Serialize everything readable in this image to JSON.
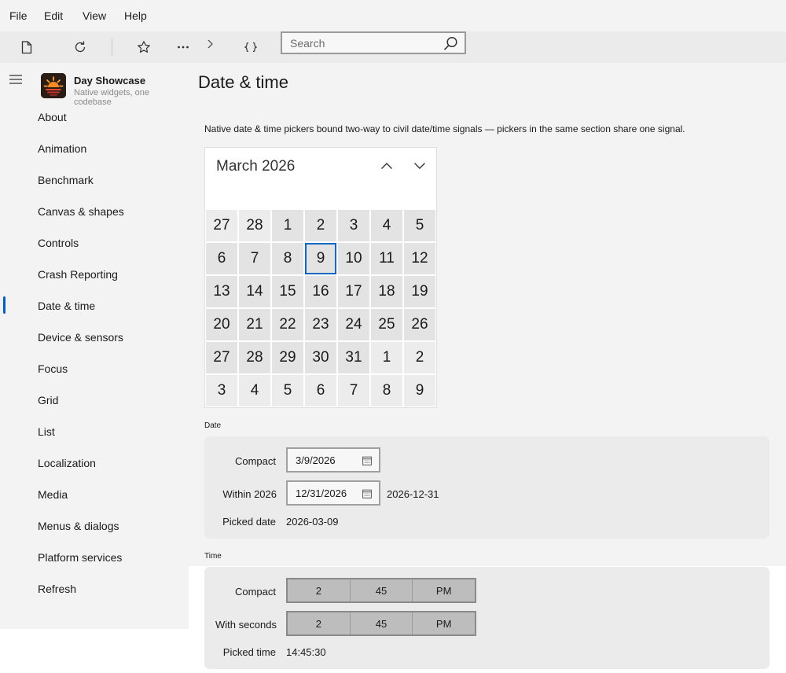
{
  "menu": {
    "file": "File",
    "edit": "Edit",
    "view": "View",
    "help": "Help"
  },
  "search": {
    "placeholder": "Search"
  },
  "app": {
    "title": "Day Showcase",
    "subtitle": "Native widgets, one codebase"
  },
  "nav": {
    "items": [
      "About",
      "Animation",
      "Benchmark",
      "Canvas & shapes",
      "Controls",
      "Crash Reporting",
      "Date & time",
      "Device & sensors",
      "Focus",
      "Grid",
      "List",
      "Localization",
      "Media",
      "Menus & dialogs",
      "Platform services",
      "Refresh"
    ],
    "selected": "Date & time"
  },
  "page": {
    "title": "Date & time",
    "description": "Native date & time pickers bound two-way to civil date/time signals — pickers in the same section share one signal."
  },
  "calendar": {
    "header": "March 2026",
    "weeks": [
      [
        "27",
        "28",
        "1",
        "2",
        "3",
        "4",
        "5"
      ],
      [
        "6",
        "7",
        "8",
        "9",
        "10",
        "11",
        "12"
      ],
      [
        "13",
        "14",
        "15",
        "16",
        "17",
        "18",
        "19"
      ],
      [
        "20",
        "21",
        "22",
        "23",
        "24",
        "25",
        "26"
      ],
      [
        "27",
        "28",
        "29",
        "30",
        "31",
        "1",
        "2"
      ],
      [
        "3",
        "4",
        "5",
        "6",
        "7",
        "8",
        "9"
      ]
    ],
    "selected_day": "9"
  },
  "date_section": {
    "label": "Date",
    "compact_label": "Compact",
    "compact_value": "3/9/2026",
    "within_label": "Within 2026",
    "within_value": "12/31/2026",
    "within_iso": "2026-12-31",
    "picked_label": "Picked date",
    "picked_value": "2026-03-09"
  },
  "time_section": {
    "label": "Time",
    "compact_label": "Compact",
    "compact": {
      "hour": "2",
      "minute": "45",
      "period": "PM"
    },
    "seconds_label": "With seconds",
    "seconds": {
      "hour": "2",
      "minute": "45",
      "period": "PM"
    },
    "picked_label": "Picked time",
    "picked_value": "14:45:30"
  },
  "colors": {
    "accent": "#005fb8",
    "selected_border": "#0067c0",
    "background": "#f3f3f3",
    "card": "#ebebeb"
  }
}
